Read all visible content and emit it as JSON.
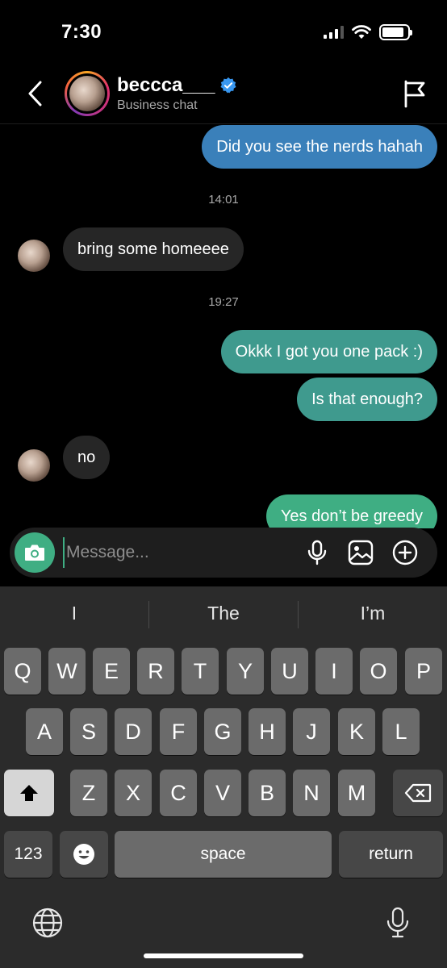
{
  "status": {
    "time": "7:30"
  },
  "header": {
    "name": "beccca___",
    "subtitle": "Business chat"
  },
  "messages": [
    {
      "type": "outgoing",
      "text": "Did you see the nerds hahah",
      "color": "#3a80ba"
    },
    {
      "type": "timestamp",
      "text": "14:01"
    },
    {
      "type": "incoming",
      "text": "bring some homeeee"
    },
    {
      "type": "timestamp",
      "text": "19:27"
    },
    {
      "type": "outgoing",
      "text": "Okkk I got you one pack :)",
      "color": "#3f9a8e"
    },
    {
      "type": "outgoing",
      "text": "Is that enough?",
      "color": "#3f9a8e"
    },
    {
      "type": "incoming",
      "text": "no"
    },
    {
      "type": "outgoing",
      "text": "Yes don’t be greedy",
      "color": "#3fae83"
    }
  ],
  "composer": {
    "placeholder": "Message..."
  },
  "keyboard": {
    "suggestions": [
      "I",
      "The",
      "I’m"
    ],
    "row1": [
      "Q",
      "W",
      "E",
      "R",
      "T",
      "Y",
      "U",
      "I",
      "O",
      "P"
    ],
    "row2": [
      "A",
      "S",
      "D",
      "F",
      "G",
      "H",
      "J",
      "K",
      "L"
    ],
    "row3": [
      "Z",
      "X",
      "C",
      "V",
      "B",
      "N",
      "M"
    ],
    "numbers_label": "123",
    "space_label": "space",
    "return_label": "return"
  },
  "colors": {
    "accent": "#3fae83",
    "verified": "#3897f0"
  }
}
